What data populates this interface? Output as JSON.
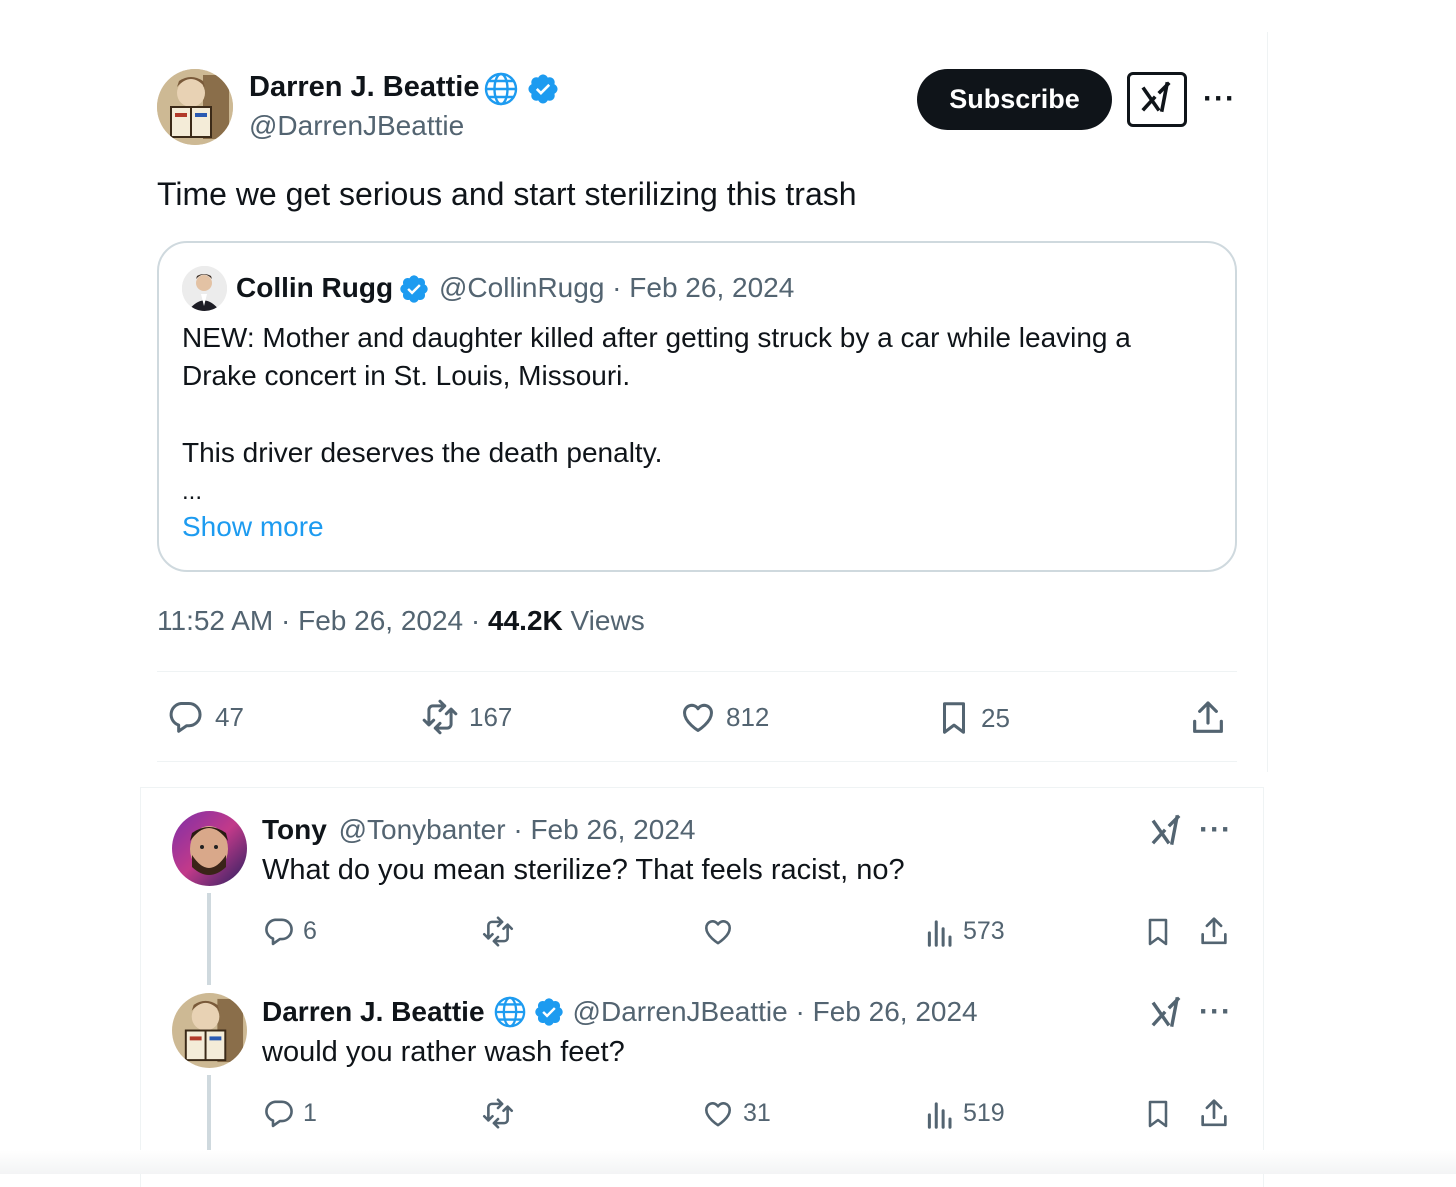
{
  "main_tweet": {
    "author_name": "Darren J. Beattie",
    "handle": "@DarrenJBeattie",
    "subscribe_label": "Subscribe",
    "text": "Time we get serious and start sterilizing this trash",
    "timestamp": "11:52 AM · Feb 26, 2024 · ",
    "views_count": "44.2K",
    "views_label": " Views",
    "stats": {
      "replies": "47",
      "reposts": "167",
      "likes": "812",
      "bookmarks": "25"
    }
  },
  "quoted_tweet": {
    "author_name": "Collin Rugg",
    "handle_date": "@CollinRugg · Feb 26, 2024",
    "line1": "NEW: Mother and daughter killed after getting struck by a car while leaving a",
    "line2": "Drake concert in St. Louis, Missouri.",
    "line3": "This driver deserves the death penalty.",
    "ellipsis": "...",
    "show_more": "Show more"
  },
  "replies": [
    {
      "author_name": "Tony",
      "handle_date": "@Tonybanter · Feb 26, 2024",
      "text": "What do you mean sterilize? That feels racist, no?",
      "stats": {
        "replies": "6",
        "reposts": "",
        "likes": "",
        "views": "573"
      }
    },
    {
      "author_name": "Darren J. Beattie",
      "handle_date": "@DarrenJBeattie · Feb 26, 2024",
      "text": "would you rather wash feet?",
      "stats": {
        "replies": "1",
        "reposts": "",
        "likes": "31",
        "views": "519"
      }
    }
  ],
  "colors": {
    "text": "#0f1419",
    "muted": "#536471",
    "accent": "#1d9bf0",
    "border": "#cfd9de"
  },
  "icons": [
    "globe-icon",
    "verified-badge-icon",
    "grok-icon",
    "more-icon",
    "reply-icon",
    "repost-icon",
    "like-icon",
    "bookmark-icon",
    "share-icon",
    "views-icon"
  ]
}
